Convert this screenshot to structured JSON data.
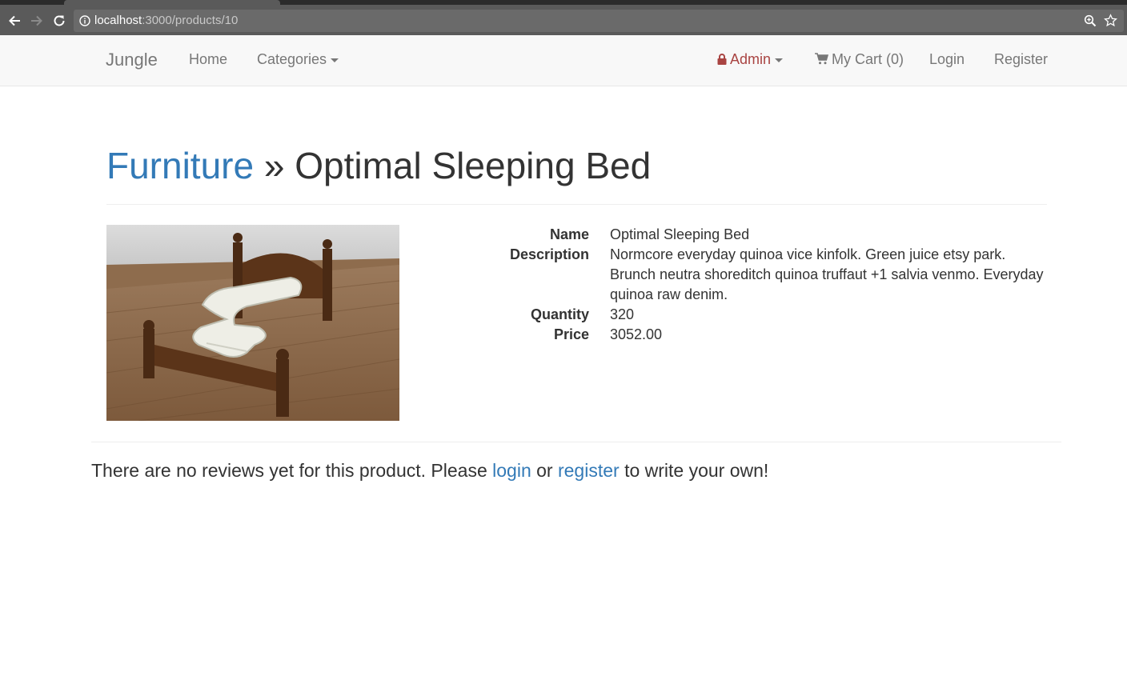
{
  "browser": {
    "url_host": "localhost",
    "url_path": ":3000/products/10"
  },
  "navbar": {
    "brand": "Jungle",
    "home": "Home",
    "categories": "Categories",
    "admin": "Admin",
    "cart": "My Cart (0)",
    "login": "Login",
    "register": "Register"
  },
  "page": {
    "category": "Furniture",
    "separator": "»",
    "title": "Optimal Sleeping Bed"
  },
  "product": {
    "labels": {
      "name": "Name",
      "description": "Description",
      "quantity": "Quantity",
      "price": "Price"
    },
    "name": "Optimal Sleeping Bed",
    "description": "Normcore everyday quinoa vice kinfolk. Green juice etsy park. Brunch neutra shoreditch quinoa truffaut +1 salvia venmo. Everyday quinoa raw denim.",
    "quantity": "320",
    "price": "3052.00"
  },
  "reviews": {
    "prefix": "There are no reviews yet for this product. Please",
    "login": "login",
    "middle": "or",
    "register": "register",
    "suffix": "to write your own!"
  },
  "colors": {
    "link": "#337ab7",
    "admin": "#a94442",
    "nav_text": "#777777",
    "chrome": "#5a5a5a"
  }
}
